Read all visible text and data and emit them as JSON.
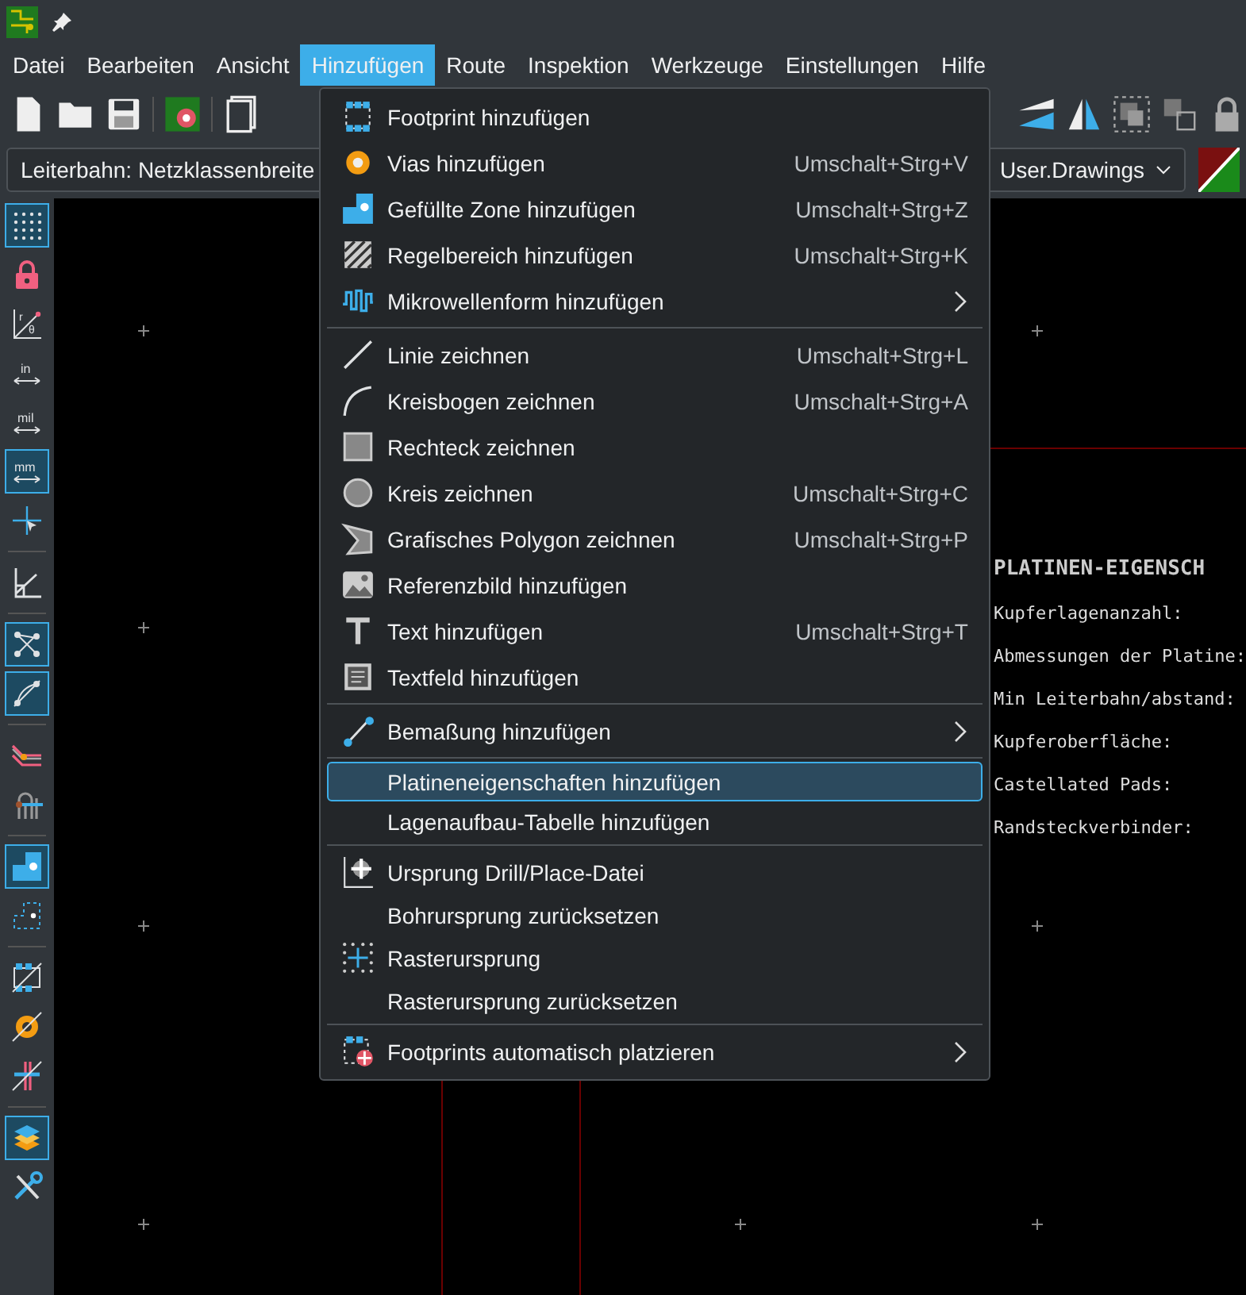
{
  "menubar": [
    {
      "label": "Datei",
      "selected": false
    },
    {
      "label": "Bearbeiten",
      "selected": false
    },
    {
      "label": "Ansicht",
      "selected": false
    },
    {
      "label": "Hinzufügen",
      "selected": true
    },
    {
      "label": "Route",
      "selected": false
    },
    {
      "label": "Inspektion",
      "selected": false
    },
    {
      "label": "Werkzeuge",
      "selected": false
    },
    {
      "label": "Einstellungen",
      "selected": false
    },
    {
      "label": "Hilfe",
      "selected": false
    }
  ],
  "track_width_select": {
    "value": "Leiterbahn: Netzklassenbreite"
  },
  "layer_select": {
    "value": "User.Drawings"
  },
  "left_toolbar": [
    {
      "tools": [
        {
          "on": true
        },
        {
          "on": false
        },
        {
          "on": false,
          "glyphs": [
            "r",
            "θ"
          ]
        },
        {
          "on": false,
          "glyphs": [
            "in"
          ]
        },
        {
          "on": false,
          "glyphs": [
            "mil"
          ]
        },
        {
          "on": true,
          "glyphs": [
            "mm"
          ]
        },
        {
          "on": false
        }
      ]
    },
    {
      "tools": [
        {
          "on": false
        }
      ]
    },
    {
      "tools": [
        {
          "on": true
        },
        {
          "on": true
        }
      ]
    },
    {
      "tools": [
        {
          "on": false
        },
        {
          "on": false
        }
      ]
    },
    {
      "tools": [
        {
          "on": true
        },
        {
          "on": false
        }
      ]
    },
    {
      "tools": [
        {
          "on": false
        },
        {
          "on": false
        },
        {
          "on": false
        }
      ]
    },
    {
      "tools": [
        {
          "on": true
        },
        {
          "on": false
        }
      ]
    }
  ],
  "menu": {
    "groups": [
      {
        "items": [
          {
            "label": "Footprint hinzufügen",
            "submenu": false,
            "selected": false
          },
          {
            "label": "Vias hinzufügen",
            "shortcut": "Umschalt+Strg+V",
            "submenu": false,
            "selected": false
          },
          {
            "label": "Gefüllte Zone hinzufügen",
            "shortcut": "Umschalt+Strg+Z",
            "submenu": false,
            "selected": false
          },
          {
            "label": "Regelbereich hinzufügen",
            "shortcut": "Umschalt+Strg+K",
            "submenu": false,
            "selected": false
          },
          {
            "label": "Mikrowellenform hinzufügen",
            "submenu": true,
            "selected": false
          }
        ]
      },
      {
        "items": [
          {
            "label": "Linie zeichnen",
            "shortcut": "Umschalt+Strg+L",
            "submenu": false,
            "selected": false
          },
          {
            "label": "Kreisbogen zeichnen",
            "shortcut": "Umschalt+Strg+A",
            "submenu": false,
            "selected": false
          },
          {
            "label": "Rechteck zeichnen",
            "submenu": false,
            "selected": false
          },
          {
            "label": "Kreis zeichnen",
            "shortcut": "Umschalt+Strg+C",
            "submenu": false,
            "selected": false
          },
          {
            "label": "Grafisches Polygon zeichnen",
            "shortcut": "Umschalt+Strg+P",
            "submenu": false,
            "selected": false
          },
          {
            "label": "Referenzbild hinzufügen",
            "submenu": false,
            "selected": false
          },
          {
            "label": "Text hinzufügen",
            "shortcut": "Umschalt+Strg+T",
            "submenu": false,
            "selected": false
          },
          {
            "label": "Textfeld hinzufügen",
            "submenu": false,
            "selected": false
          }
        ]
      },
      {
        "items": [
          {
            "label": "Bemaßung hinzufügen",
            "submenu": true,
            "selected": false
          }
        ]
      },
      {
        "items": [
          {
            "label": "Platineneigenschaften hinzufügen",
            "submenu": false,
            "selected": true
          },
          {
            "label": "Lagenaufbau-Tabelle hinzufügen",
            "submenu": false,
            "selected": false
          }
        ]
      },
      {
        "items": [
          {
            "label": "Ursprung Drill/Place-Datei",
            "submenu": false,
            "selected": false
          },
          {
            "label": "Bohrursprung zurücksetzen",
            "submenu": false,
            "selected": false
          },
          {
            "label": "Rasterursprung",
            "submenu": false,
            "selected": false
          },
          {
            "label": "Rasterursprung zurücksetzen",
            "submenu": false,
            "selected": false
          }
        ]
      },
      {
        "items": [
          {
            "label": "Footprints automatisch platzieren",
            "submenu": true,
            "selected": false
          }
        ]
      }
    ]
  },
  "board_properties": {
    "title": "PLATINEN-EIGENSCH",
    "lines": [
      "Kupferlagenanzahl:",
      "Abmessungen der Platine:",
      "Min Leiterbahn/abstand:",
      "Kupferoberfläche:",
      "Castellated Pads:",
      "Randsteckverbinder:"
    ]
  }
}
